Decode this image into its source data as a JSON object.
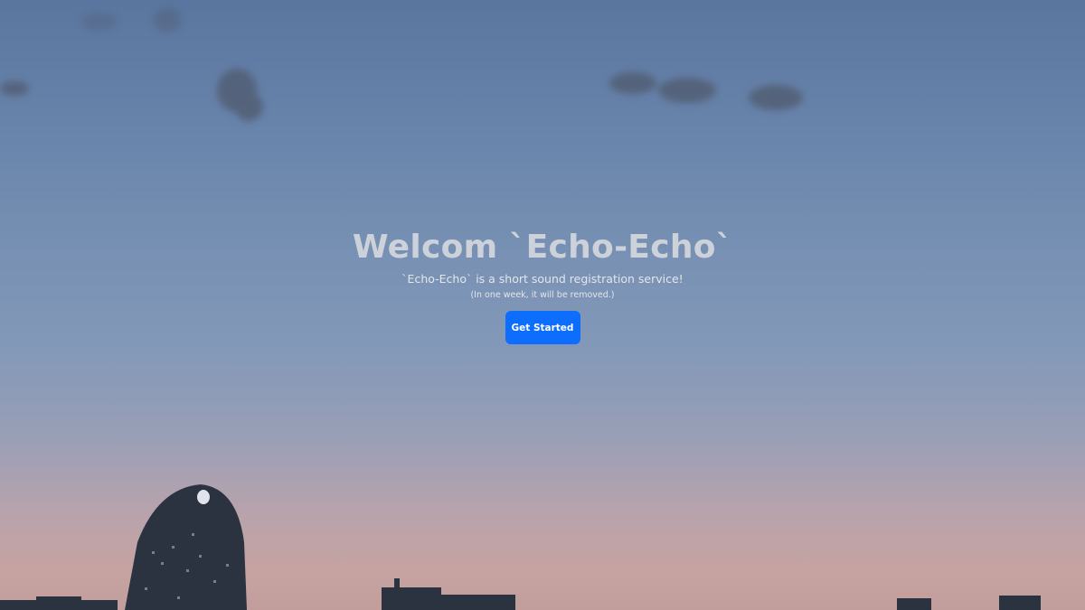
{
  "hero": {
    "title": "Welcom `Echo-Echo`",
    "subtitle": "`Echo-Echo` is a short sound registration service!",
    "note": "(In one week, it will be removed.)",
    "cta_label": "Get Started"
  },
  "colors": {
    "sky_top": "#5a769f",
    "sky_bottom": "#c19e9c",
    "button": "#0d6efd",
    "title": "#cdd1d9"
  }
}
